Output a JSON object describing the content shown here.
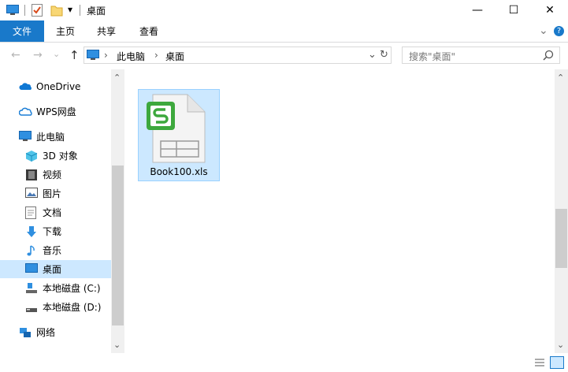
{
  "window": {
    "title": "桌面",
    "qat_dropdown": "▾",
    "minimize": "—",
    "maximize": "☐",
    "close": "✕"
  },
  "ribbon": {
    "tabs": [
      "文件",
      "主页",
      "共享",
      "查看"
    ],
    "expand": "⌄",
    "help": "?"
  },
  "navigation": {
    "back": "←",
    "forward": "→",
    "recent": "⌄",
    "up": "↑",
    "breadcrumb": [
      "此电脑",
      "桌面"
    ],
    "breadcrumb_sep": "›",
    "dropdown": "⌄",
    "refresh": "↻"
  },
  "search": {
    "placeholder": "搜索\"桌面\""
  },
  "sidebar": {
    "items": [
      {
        "label": "OneDrive",
        "icon": "onedrive-cloud-icon",
        "indent": 0
      },
      {
        "label": "WPS网盘",
        "icon": "wps-cloud-icon",
        "indent": 0
      },
      {
        "label": "此电脑",
        "icon": "computer-icon",
        "indent": 0
      },
      {
        "label": "3D 对象",
        "icon": "cube-3d-icon",
        "indent": 1
      },
      {
        "label": "视频",
        "icon": "video-icon",
        "indent": 1
      },
      {
        "label": "图片",
        "icon": "picture-icon",
        "indent": 1
      },
      {
        "label": "文档",
        "icon": "document-icon",
        "indent": 1
      },
      {
        "label": "下载",
        "icon": "download-icon",
        "indent": 1
      },
      {
        "label": "音乐",
        "icon": "music-icon",
        "indent": 1
      },
      {
        "label": "桌面",
        "icon": "desktop-icon",
        "indent": 1,
        "selected": true
      },
      {
        "label": "本地磁盘 (C:)",
        "icon": "drive-icon",
        "indent": 1
      },
      {
        "label": "本地磁盘 (D:)",
        "icon": "drive-icon",
        "indent": 1
      },
      {
        "label": "网络",
        "icon": "network-icon",
        "indent": 0
      }
    ],
    "scroll_up": "⌃",
    "scroll_down": "⌄"
  },
  "files": [
    {
      "name": "Book100.xls",
      "icon": "wps-spreadsheet-icon",
      "selected": true
    }
  ],
  "colors": {
    "accent": "#1979ca",
    "selection": "#cce8ff",
    "selection_border": "#99d1ff",
    "wps_green": "#3da83d"
  }
}
